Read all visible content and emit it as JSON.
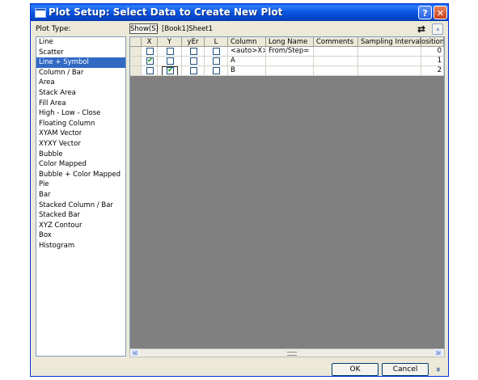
{
  "window": {
    "title": "Plot Setup: Select Data to Create New Plot",
    "help_label": "?",
    "close_label": "✕"
  },
  "plot_type": {
    "label": "Plot Type:",
    "selected": "Line + Symbol",
    "items": [
      "Line",
      "Scatter",
      "Line + Symbol",
      "Column / Bar",
      "Area",
      "Stack Area",
      "Fill Area",
      "High - Low - Close",
      "Floating Column",
      "XYAM Vector",
      "XYXY Vector",
      "Bubble",
      "Color Mapped",
      "Bubble + Color Mapped",
      "Pie",
      "Bar",
      "Stacked Column / Bar",
      "Stacked Bar",
      "XYZ Contour",
      "Box",
      "Histogram"
    ]
  },
  "toolbar": {
    "show_label": "Show(S)",
    "sheet": "[Book1]Sheet1",
    "swap_icon": "⇄",
    "collapse_icon": "«"
  },
  "grid": {
    "headers": [
      "X",
      "Y",
      "yEr",
      "L",
      "Column",
      "Long Name",
      "Comments",
      "Sampling Interval",
      "osition"
    ],
    "rows": [
      {
        "x": false,
        "y": false,
        "yer": false,
        "l": false,
        "column": "<auto>X>",
        "long_name": "From/Step=",
        "comments": "",
        "sampling": "",
        "position": "0"
      },
      {
        "x": true,
        "y": false,
        "yer": false,
        "l": false,
        "column": "A",
        "long_name": "",
        "comments": "",
        "sampling": "",
        "position": "1"
      },
      {
        "x": false,
        "y": true,
        "yer": false,
        "l": false,
        "column": "B",
        "long_name": "",
        "comments": "",
        "sampling": "",
        "position": "2"
      }
    ]
  },
  "buttons": {
    "ok": "OK",
    "cancel": "Cancel",
    "more_icon": "»"
  },
  "check_glyph": "✔",
  "scroll": {
    "left_icon": "<",
    "right_icon": ">"
  }
}
